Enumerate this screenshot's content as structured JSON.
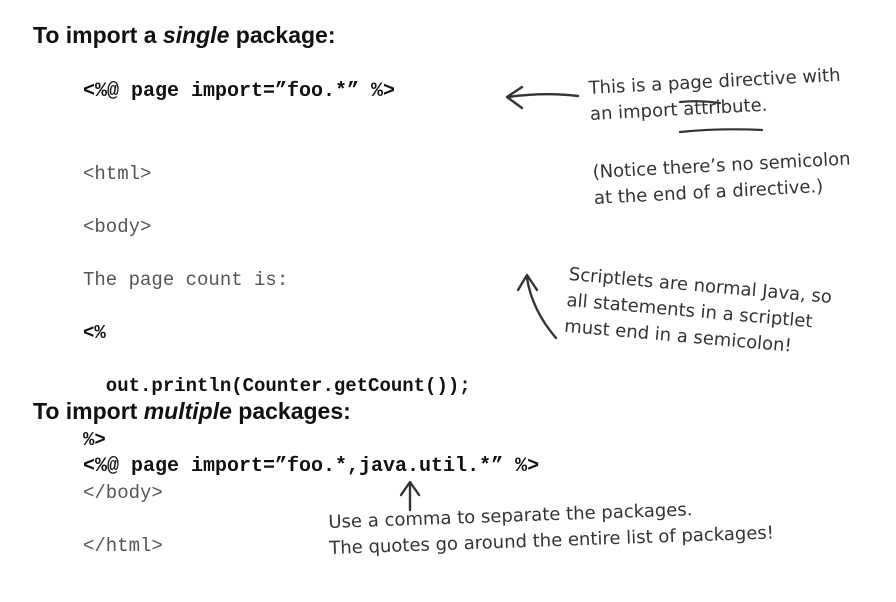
{
  "section1": {
    "heading_prefix": "To import a ",
    "heading_emph": "single",
    "heading_suffix": " package:",
    "directive": "<%@ page import=”foo.*” %>",
    "code_lines": [
      "<html>",
      "<body>",
      "The page count is:",
      "<%",
      "  out.println(Counter.getCount());",
      "%>",
      "</body>",
      "</html>"
    ],
    "note_directive_l1": "This is a page directive with",
    "note_directive_l2": "an import attribute.",
    "note_semicolon_l1": "(Notice there’s no semicolon",
    "note_semicolon_l2": "at the end of a directive.)",
    "note_scriptlet_l1": "Scriptlets are normal Java, so",
    "note_scriptlet_l2": "all statements in a scriptlet",
    "note_scriptlet_l3": "must end in a semicolon!"
  },
  "section2": {
    "heading_prefix": "To import ",
    "heading_emph": "multiple",
    "heading_suffix": " packages:",
    "directive": "<%@ page import=”foo.*,java.util.*” %>",
    "note_comma_l1": "Use a comma to separate the packages.",
    "note_comma_l2": "The quotes go around the entire list of packages!"
  }
}
